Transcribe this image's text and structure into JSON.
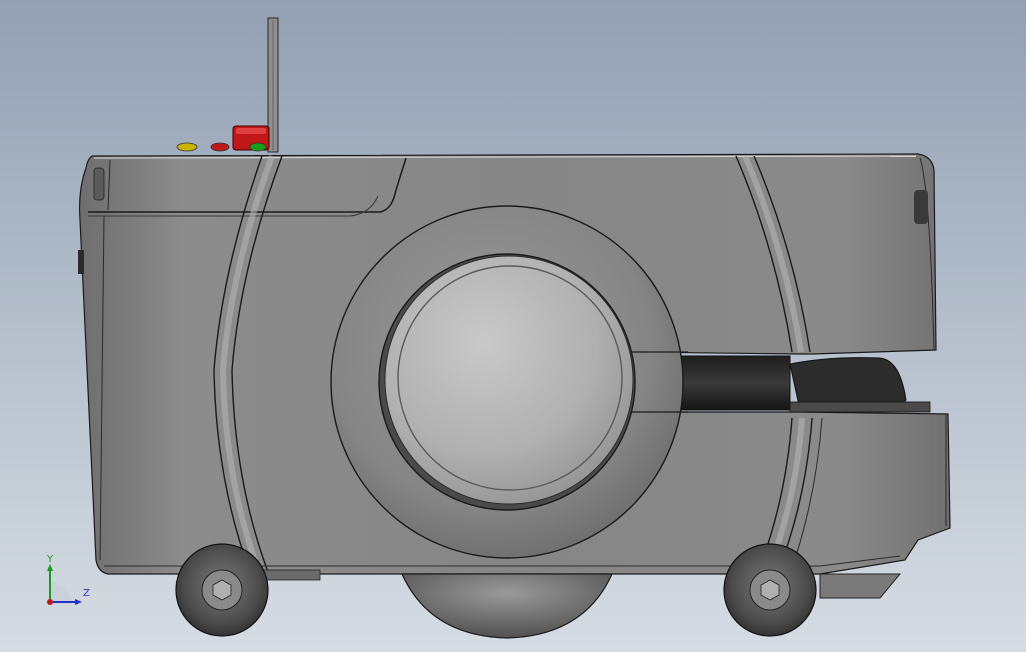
{
  "viewport": {
    "background_top": "#93a0b3",
    "background_bottom": "#d6dce3"
  },
  "model": {
    "description_icon": "mobile-robot-side-view",
    "body_color": "#8a8a8a",
    "estop_color": "#c01818",
    "indicator_colors": [
      "#c8b400",
      "#c01818",
      "#18a018"
    ]
  },
  "triad": {
    "y_label": "Y",
    "z_label": "Z",
    "y_color": "#1a9a1a",
    "z_color": "#2233cc",
    "origin_color": "#c01818"
  }
}
